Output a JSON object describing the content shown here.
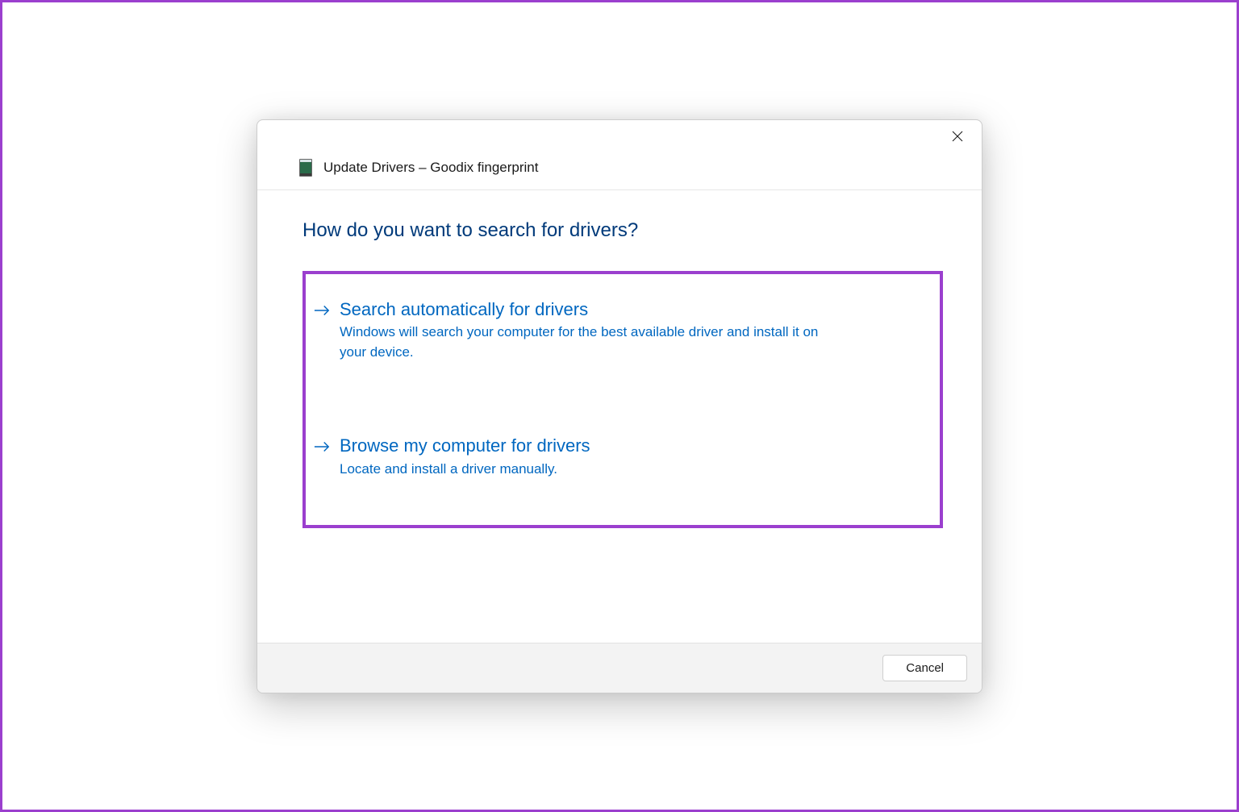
{
  "dialog": {
    "title": "Update Drivers – Goodix fingerprint",
    "heading": "How do you want to search for drivers?",
    "options": [
      {
        "title": "Search automatically for drivers",
        "description": "Windows will search your computer for the best available driver and install it on your device."
      },
      {
        "title": "Browse my computer for drivers",
        "description": "Locate and install a driver manually."
      }
    ],
    "cancel_label": "Cancel"
  },
  "colors": {
    "highlight_border": "#9b3fce",
    "link_blue": "#0067c0",
    "heading_blue": "#003a7a"
  }
}
